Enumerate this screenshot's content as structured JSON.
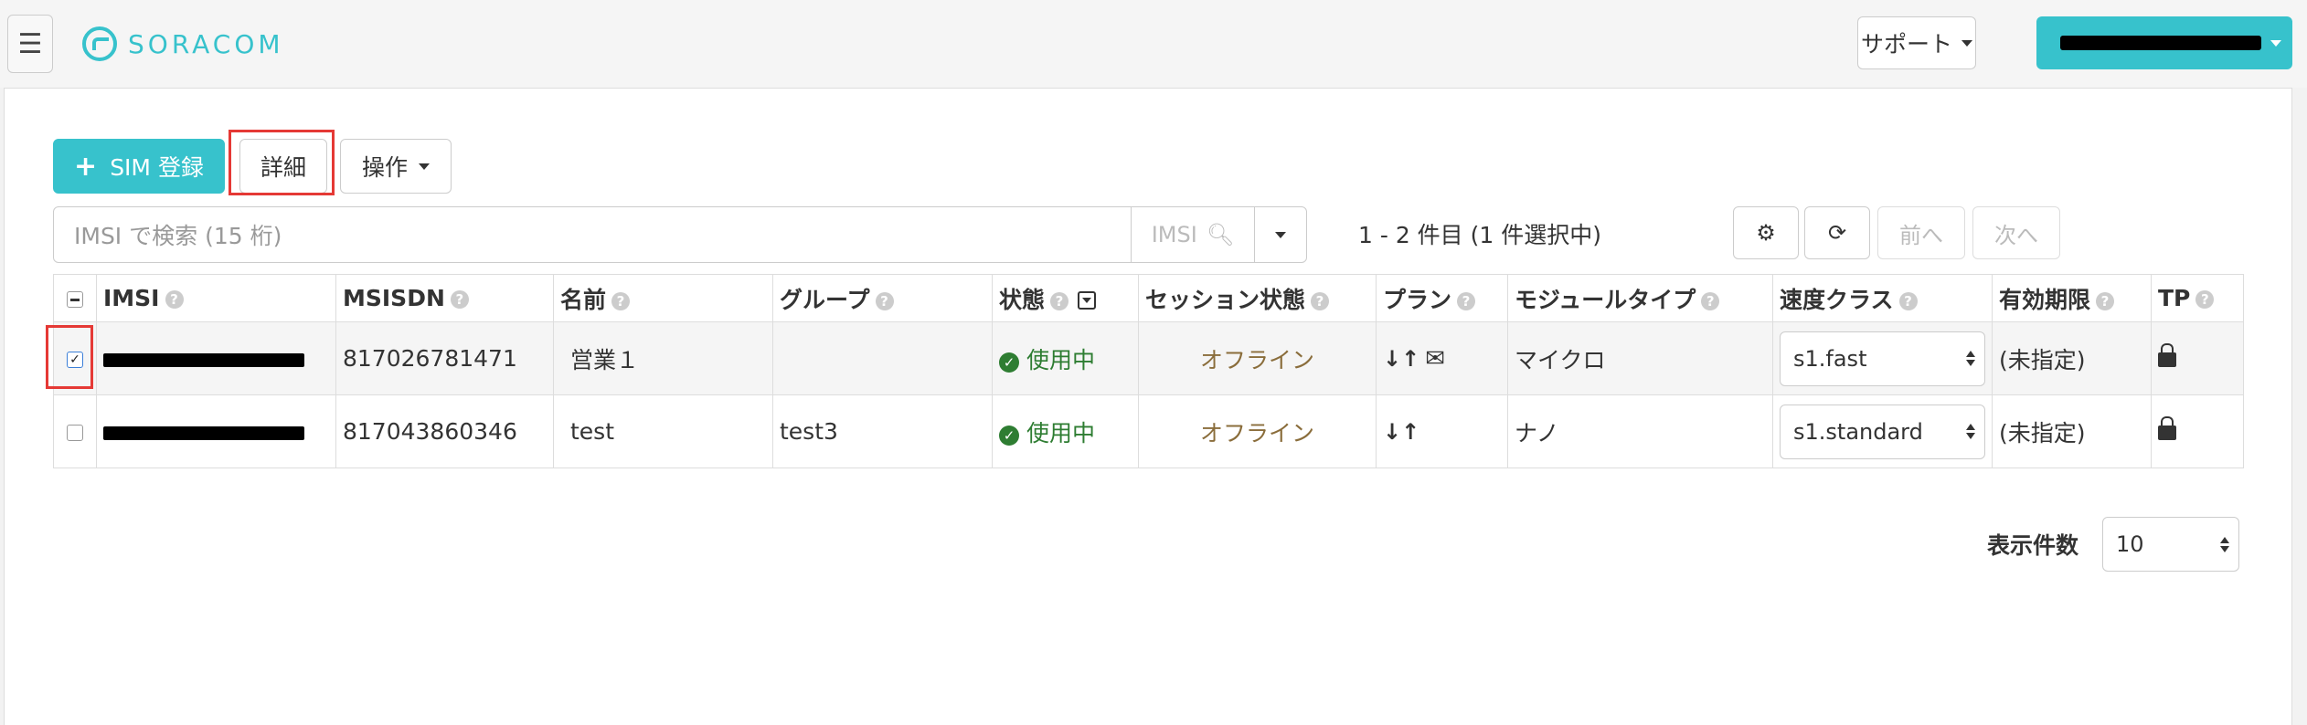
{
  "navbar": {
    "menu_icon": "hamburger-icon",
    "brand": "SORACOM",
    "support_label": "サポート",
    "user_label": ""
  },
  "toolbar": {
    "add_sim_label": "SIM 登録",
    "details_label": "詳細",
    "actions_label": "操作"
  },
  "search": {
    "placeholder": "IMSI で検索 (15 桁)",
    "type_label": "IMSI",
    "range_text": "1 - 2 件目 (1 件選択中)",
    "prev_label": "前へ",
    "next_label": "次へ"
  },
  "table": {
    "headers": {
      "imsi": "IMSI",
      "msisdn": "MSISDN",
      "name": "名前",
      "group": "グループ",
      "status": "状態",
      "session": "セッション状態",
      "plan": "プラン",
      "module": "モジュールタイプ",
      "speed": "速度クラス",
      "expiry": "有効期限",
      "tp": "TP"
    },
    "rows": [
      {
        "selected": true,
        "msisdn": "817026781471",
        "name": "営業１",
        "group": "",
        "status": "使用中",
        "session": "オフライン",
        "module": "マイクロ",
        "speed": "s1.fast",
        "expiry": "(未指定)"
      },
      {
        "selected": false,
        "msisdn": "817043860346",
        "name": "test",
        "group": "test3",
        "status": "使用中",
        "session": "オフライン",
        "module": "ナノ",
        "speed": "s1.standard",
        "expiry": "(未指定)"
      }
    ]
  },
  "pagination": {
    "per_page_label": "表示件数",
    "per_page_value": "10"
  },
  "colors": {
    "accent": "#37c2cc",
    "status_green": "#2e7d32",
    "offline_brown": "#8a6d3b",
    "highlight_red": "#e53935"
  }
}
